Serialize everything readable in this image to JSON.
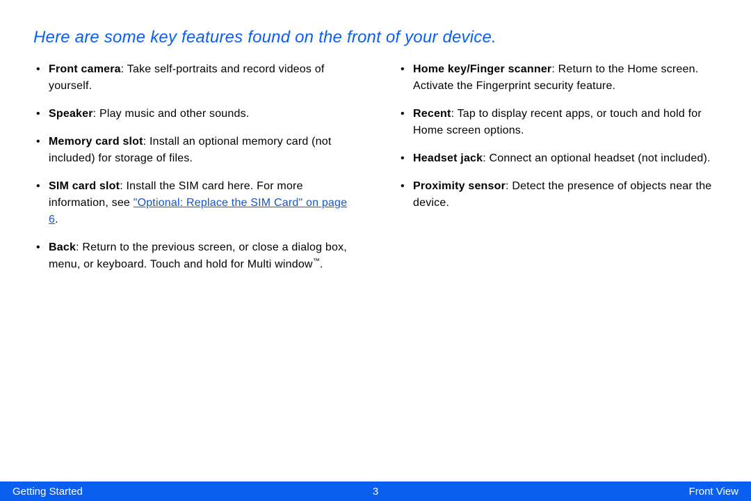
{
  "heading": "Here are some key features found on the front of your device.",
  "left": {
    "items": [
      {
        "term": "Front camera",
        "desc": ": Take self-portraits and record videos of yourself."
      },
      {
        "term": "Speaker",
        "desc": ": Play music and other sounds."
      },
      {
        "term": "Memory card slot",
        "desc": ": Install an optional memory card (not included) for storage of files."
      },
      {
        "term": "SIM card slot",
        "desc_before": ": Install the SIM card here. For more information, see ",
        "link_text": "\"Optional: Replace the SIM Card\" on page 6",
        "desc_after": "."
      },
      {
        "term": "Back",
        "desc_before": ": Return to the previous screen, or close a dialog box, menu, or keyboard. Touch and hold for Multi window",
        "tm": "™",
        "desc_after": "."
      }
    ]
  },
  "right": {
    "items": [
      {
        "term": "Home key/Finger scanner",
        "desc": ": Return to the Home screen. Activate the Fingerprint security feature."
      },
      {
        "term": "Recent",
        "desc": ": Tap to display recent apps, or touch and hold for Home screen options."
      },
      {
        "term": "Headset jack",
        "desc": ": Connect an optional headset (not included)."
      },
      {
        "term": "Proximity sensor",
        "desc": ": Detect the presence of objects near the device."
      }
    ]
  },
  "footer": {
    "left": "Getting Started",
    "center": "3",
    "right": "Front View"
  }
}
